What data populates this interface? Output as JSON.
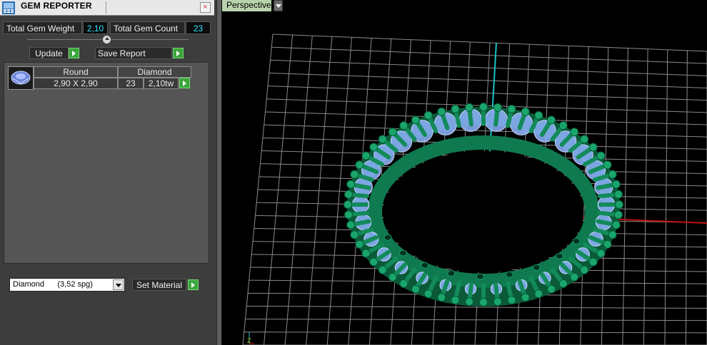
{
  "window": {
    "title": "GEM REPORTER",
    "close_glyph": "×"
  },
  "summary": {
    "weight_label": "Total Gem Weight",
    "weight_value": "2,10",
    "count_label": "Total Gem Count",
    "count_value": "23"
  },
  "toolbar": {
    "update_label": "Update",
    "save_report_label": "Save Report"
  },
  "gem_table": {
    "headers": [
      "Round",
      "Diamond"
    ],
    "rows": [
      {
        "size": "2,90 X 2,90",
        "count": "23",
        "weight": "2,10tw"
      }
    ]
  },
  "material": {
    "selected": "Diamond      (3,52 spg)",
    "set_label": "Set Material"
  },
  "viewport": {
    "view_mode": "Perspective",
    "axis_indicator": "Z"
  },
  "colors": {
    "accent_cyan": "#2fe0ff",
    "go_green": "#3aa53a",
    "metal": "#0f7a4f",
    "gem": "#8fb4ff",
    "grid": "#8a8a8a",
    "x_axis": "#c01010",
    "z_axis": "#19c3c3"
  },
  "icons": {
    "app": "gem-reporter-icon",
    "close": "close-icon",
    "go": "play-arrow-icon",
    "dropdown": "chevron-down-icon",
    "slider": "slider-knob-icon"
  }
}
